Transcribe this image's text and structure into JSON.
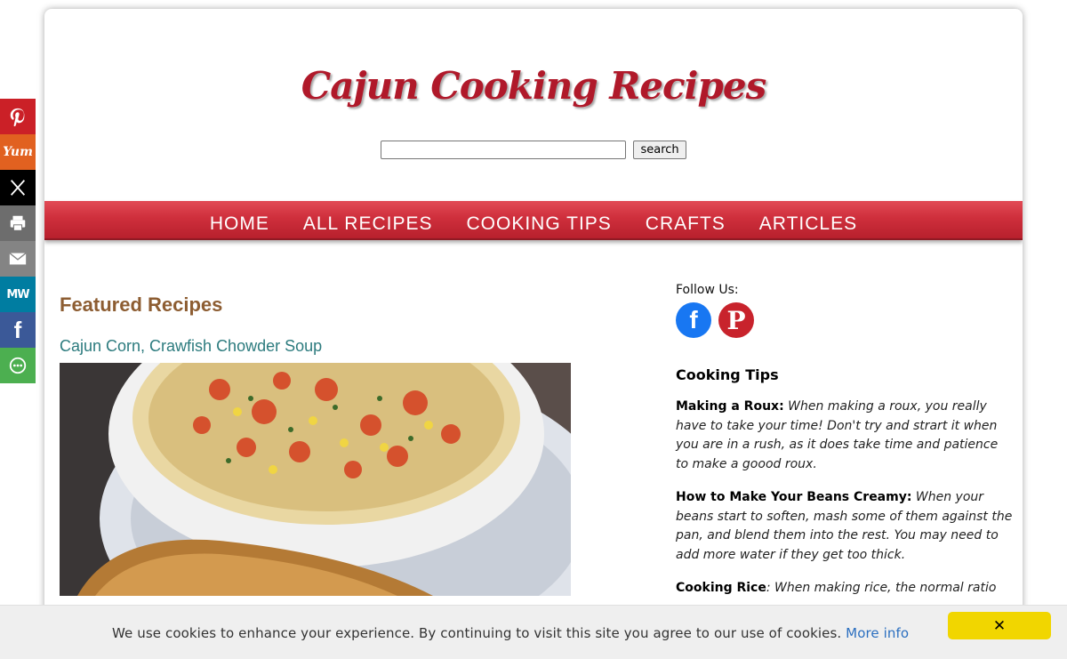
{
  "site": {
    "logo_text": "Cajun Cooking Recipes",
    "search": {
      "value": "",
      "button_label": "search"
    }
  },
  "nav": {
    "items": [
      {
        "label": "HOME"
      },
      {
        "label": "ALL RECIPES"
      },
      {
        "label": "COOKING TIPS"
      },
      {
        "label": "CRAFTS"
      },
      {
        "label": "ARTICLES"
      }
    ]
  },
  "main": {
    "featured_heading": "Featured Recipes",
    "recipe_title": "Cajun Corn, Crawfish Chowder Soup"
  },
  "sidebar": {
    "follow_label": "Follow Us:",
    "social": [
      {
        "icon": "facebook-icon",
        "glyph": "f",
        "color": "#1877f2"
      },
      {
        "icon": "pinterest-icon",
        "glyph": "P",
        "color": "#c8232c"
      }
    ],
    "tips_heading": "Cooking Tips",
    "tips": [
      {
        "title": "Making a Roux:",
        "text": " When making a roux, you really have to take your time! Don't try and strart it when you are in a rush, as it does take time and patience to make a goood roux."
      },
      {
        "title": "How to Make Your Beans Creamy:",
        "text": " When your beans start to soften, mash some of them against the pan, and blend them into the rest. You may need to add more water if they get too thick."
      },
      {
        "title": "Cooking Rice",
        "text": ": When making rice, the normal ratio"
      }
    ]
  },
  "share_bar": [
    {
      "icon": "pinterest-icon",
      "color": "#cb2027",
      "glyph": "P"
    },
    {
      "icon": "yummly-icon",
      "color": "#e16120",
      "glyph": "Yum"
    },
    {
      "icon": "x-icon",
      "color": "#000000",
      "glyph": "✕"
    },
    {
      "icon": "print-icon",
      "color": "#6d6d6d",
      "glyph": "🖶"
    },
    {
      "icon": "email-icon",
      "color": "#848484",
      "glyph": "✉"
    },
    {
      "icon": "mewe-icon",
      "color": "#007da1",
      "glyph": "MW"
    },
    {
      "icon": "facebook-icon",
      "color": "#3b5998",
      "glyph": "f"
    },
    {
      "icon": "more-options-icon",
      "color": "#4caf50",
      "glyph": "⋯"
    }
  ],
  "cookie": {
    "message": "We use cookies to enhance your experience. By continuing to visit this site you agree to our use of cookies.",
    "more_info": "More info",
    "close_glyph": "✕"
  }
}
